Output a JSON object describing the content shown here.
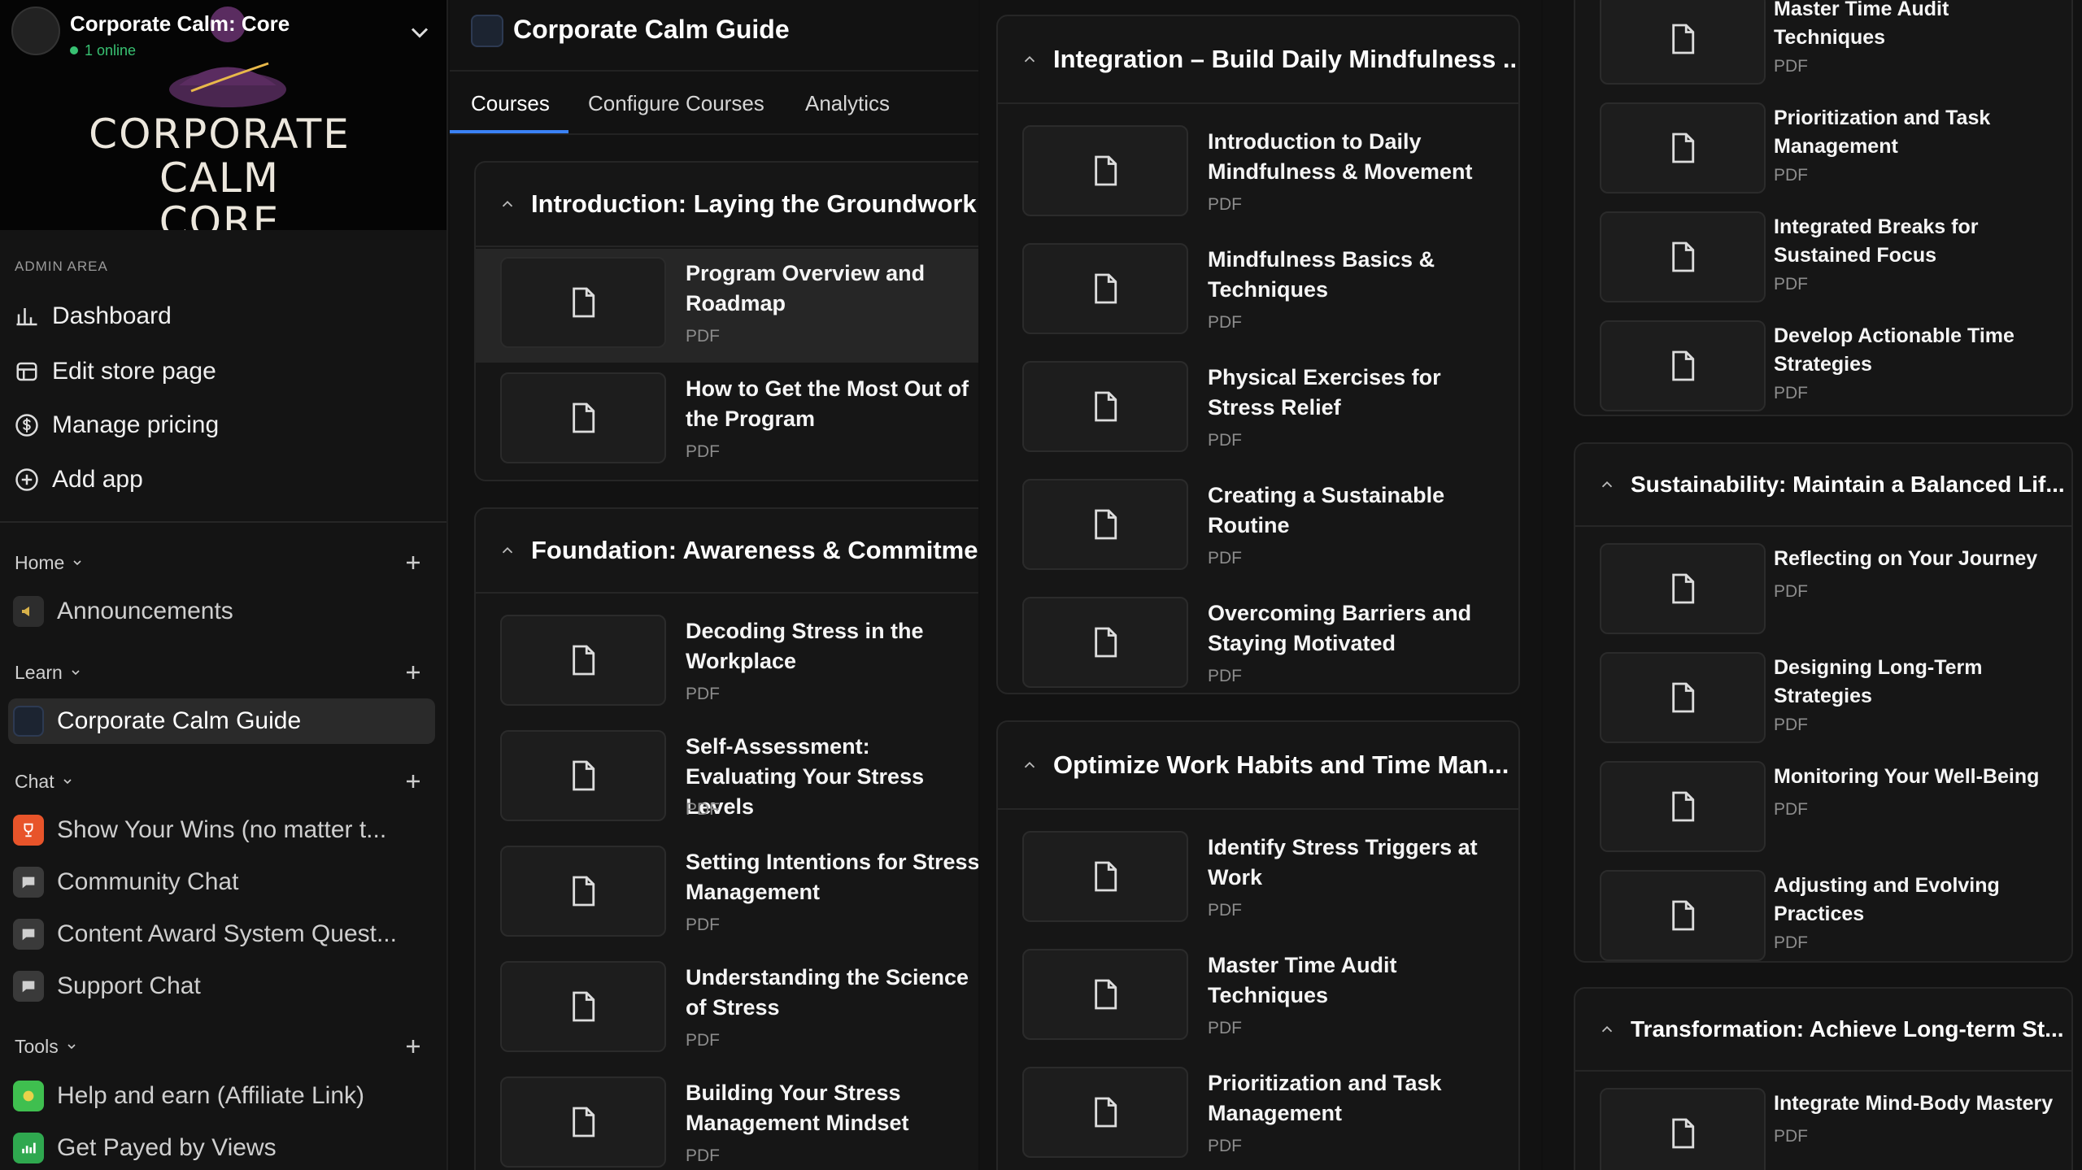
{
  "workspace": {
    "name": "Corporate Calm: Core",
    "online": "1 online",
    "logo_text": "CORPORATE\nCALM\nCORE"
  },
  "admin": {
    "label": "ADMIN AREA",
    "items": [
      {
        "label": "Dashboard",
        "icon": "chart-icon"
      },
      {
        "label": "Edit store page",
        "icon": "store-icon"
      },
      {
        "label": "Manage pricing",
        "icon": "dollar-icon"
      },
      {
        "label": "Add app",
        "icon": "plus-circle-icon"
      }
    ]
  },
  "groups": {
    "home": {
      "label": "Home",
      "items": [
        {
          "label": "Announcements",
          "icon": "megaphone-icon"
        }
      ]
    },
    "learn": {
      "label": "Learn",
      "items": [
        {
          "label": "Corporate Calm Guide",
          "icon": "course-icon",
          "active": true
        }
      ]
    },
    "chat": {
      "label": "Chat",
      "items": [
        {
          "label": "Show Your Wins (no matter t...",
          "icon": "trophy-icon",
          "color": "#e8542a"
        },
        {
          "label": "Community Chat",
          "icon": "chat-icon",
          "color": "#3a3a3a"
        },
        {
          "label": "Content Award System Quest...",
          "icon": "chat-icon",
          "color": "#3a3a3a"
        },
        {
          "label": "Support Chat",
          "icon": "chat-icon",
          "color": "#3a3a3a"
        }
      ]
    },
    "tools": {
      "label": "Tools",
      "items": [
        {
          "label": "Help and earn (Affiliate Link)",
          "icon": "money-icon",
          "color": "#3fbf4f"
        },
        {
          "label": "Get Payed by Views",
          "icon": "chart-up-icon",
          "color": "#2fa84f"
        }
      ]
    }
  },
  "course": {
    "title": "Corporate Calm Guide",
    "tabs": [
      "Courses",
      "Configure Courses",
      "Analytics"
    ]
  },
  "sections": [
    {
      "title": "Introduction: Laying the Groundwork ...",
      "lessons": [
        {
          "title": "Program Overview and Roadmap",
          "type": "PDF"
        },
        {
          "title": "How to Get the Most Out of the Program",
          "type": "PDF"
        }
      ]
    },
    {
      "title": "Foundation: Awareness & Commitment",
      "lessons": [
        {
          "title": "Decoding Stress in the Workplace",
          "type": "PDF"
        },
        {
          "title": "Self-Assessment: Evaluating Your Stress Levels",
          "type": "PDF"
        },
        {
          "title": "Setting Intentions for Stress Management",
          "type": "PDF"
        },
        {
          "title": "Understanding the Science of Stress",
          "type": "PDF"
        },
        {
          "title": "Building Your Stress Management Mindset",
          "type": "PDF"
        }
      ]
    },
    {
      "title": "Integration – Build Daily Mindfulness ...",
      "lessons": [
        {
          "title": "Introduction to Daily Mindfulness & Movement",
          "type": "PDF"
        },
        {
          "title": "Mindfulness Basics & Techniques",
          "type": "PDF"
        },
        {
          "title": "Physical Exercises for Stress Relief",
          "type": "PDF"
        },
        {
          "title": "Creating a Sustainable Routine",
          "type": "PDF"
        },
        {
          "title": "Overcoming Barriers and Staying Motivated",
          "type": "PDF"
        }
      ]
    },
    {
      "title": "Optimize Work Habits and Time Man...",
      "lessons": [
        {
          "title": "Identify Stress Triggers at Work",
          "type": "PDF"
        },
        {
          "title": "Master Time Audit Techniques",
          "type": "PDF"
        },
        {
          "title": "Prioritization and Task Management",
          "type": "PDF"
        }
      ]
    },
    {
      "title": "",
      "lessons": [
        {
          "title": "Master Time Audit Techniques",
          "type": "PDF"
        },
        {
          "title": "Prioritization and Task Management",
          "type": "PDF"
        },
        {
          "title": "Integrated Breaks for Sustained Focus",
          "type": "PDF"
        },
        {
          "title": "Develop Actionable Time Strategies",
          "type": "PDF"
        }
      ]
    },
    {
      "title": "Sustainability: Maintain a Balanced Lif...",
      "lessons": [
        {
          "title": "Reflecting on Your Journey",
          "type": "PDF"
        },
        {
          "title": "Designing Long-Term Strategies",
          "type": "PDF"
        },
        {
          "title": "Monitoring Your Well-Being",
          "type": "PDF"
        },
        {
          "title": "Adjusting and Evolving Practices",
          "type": "PDF"
        }
      ]
    },
    {
      "title": "Transformation: Achieve Long-term St...",
      "lessons": [
        {
          "title": "Integrate Mind-Body Mastery",
          "type": "PDF"
        }
      ]
    }
  ],
  "colors": {
    "accent": "#3b82f6",
    "online": "#38c172"
  }
}
